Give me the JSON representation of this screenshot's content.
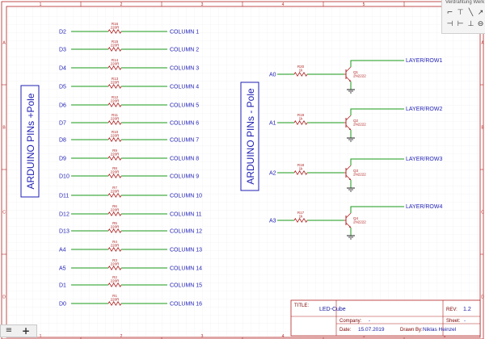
{
  "sheet": {
    "border_color": "#b22222",
    "wire_color": "#1a9a1a",
    "label_color": "#1f1fb4",
    "component_color": "#b22222",
    "frame_col_labels": [
      "1",
      "2",
      "3",
      "4",
      "5",
      "6"
    ],
    "frame_row_labels": [
      "A",
      "B",
      "C",
      "D"
    ]
  },
  "left_box": {
    "label": "ARDUINO PINs +Pole"
  },
  "right_box": {
    "label": "ARDUINO PINs - Pole"
  },
  "column_rows": [
    {
      "pin": "D2",
      "ref": "R16",
      "value": "220R",
      "net": "COLUMN 1"
    },
    {
      "pin": "D3",
      "ref": "R15",
      "value": "220R",
      "net": "COLUMN 2"
    },
    {
      "pin": "D4",
      "ref": "R14",
      "value": "220R",
      "net": "COLUMN 3"
    },
    {
      "pin": "D5",
      "ref": "R13",
      "value": "220R",
      "net": "COLUMN 4"
    },
    {
      "pin": "D6",
      "ref": "R12",
      "value": "220R",
      "net": "COLUMN 5"
    },
    {
      "pin": "D7",
      "ref": "R11",
      "value": "220R",
      "net": "COLUMN 6"
    },
    {
      "pin": "D8",
      "ref": "R10",
      "value": "220R",
      "net": "COLUMN 7"
    },
    {
      "pin": "D9",
      "ref": "R9",
      "value": "220R",
      "net": "COLUMN 8"
    },
    {
      "pin": "D10",
      "ref": "R8",
      "value": "220R",
      "net": "COLUMN 9"
    },
    {
      "pin": "D11",
      "ref": "R7",
      "value": "220R",
      "net": "COLUMN 10"
    },
    {
      "pin": "D12",
      "ref": "R6",
      "value": "220R",
      "net": "COLUMN 11"
    },
    {
      "pin": "D13",
      "ref": "R5",
      "value": "220R",
      "net": "COLUMN 12"
    },
    {
      "pin": "A4",
      "ref": "R4",
      "value": "220R",
      "net": "COLUMN 13"
    },
    {
      "pin": "A5",
      "ref": "R3",
      "value": "220R",
      "net": "COLUMN 14"
    },
    {
      "pin": "D1",
      "ref": "R2",
      "value": "220R",
      "net": "COLUMN 15"
    },
    {
      "pin": "D0",
      "ref": "R1",
      "value": "220R",
      "net": "COLUMN 16"
    }
  ],
  "layer_rows": [
    {
      "pin": "A0",
      "ref": "R20",
      "value": "1k",
      "q": "Q1",
      "part": "2N2222",
      "net": "LAYER/ROW1"
    },
    {
      "pin": "A1",
      "ref": "R19",
      "value": "1k",
      "q": "Q2",
      "part": "2N2222",
      "net": "LAYER/ROW2"
    },
    {
      "pin": "A2",
      "ref": "R18",
      "value": "1k",
      "q": "Q3",
      "part": "2N2222",
      "net": "LAYER/ROW3"
    },
    {
      "pin": "A3",
      "ref": "R17",
      "value": "1k",
      "q": "Q4",
      "part": "2N2222",
      "net": "LAYER/ROW4"
    }
  ],
  "title_block": {
    "title_label": "TITLE:",
    "title": "LED-Cube",
    "rev_label": "REV:",
    "rev": "1.2",
    "company_label": "Company:",
    "company": "-",
    "sheet_label": "Sheet:",
    "sheet": "-",
    "date_label": "Date:",
    "date": "15.07.2019",
    "drawn_label": "Drawn By:",
    "drawn": "Niklas Heinzel"
  },
  "tool_panel": {
    "title": "Verdrahtung Werk",
    "tools": [
      "wire-tool-icon",
      "bus-tool-icon",
      "line-tool-icon",
      "arrow-tool-icon",
      "junction-tool-icon",
      "netport-tool-icon",
      "power-tool-icon",
      "no-connect-tool-icon"
    ]
  },
  "bottom_bar": {
    "menu_label": "≡",
    "add_label": "+"
  }
}
